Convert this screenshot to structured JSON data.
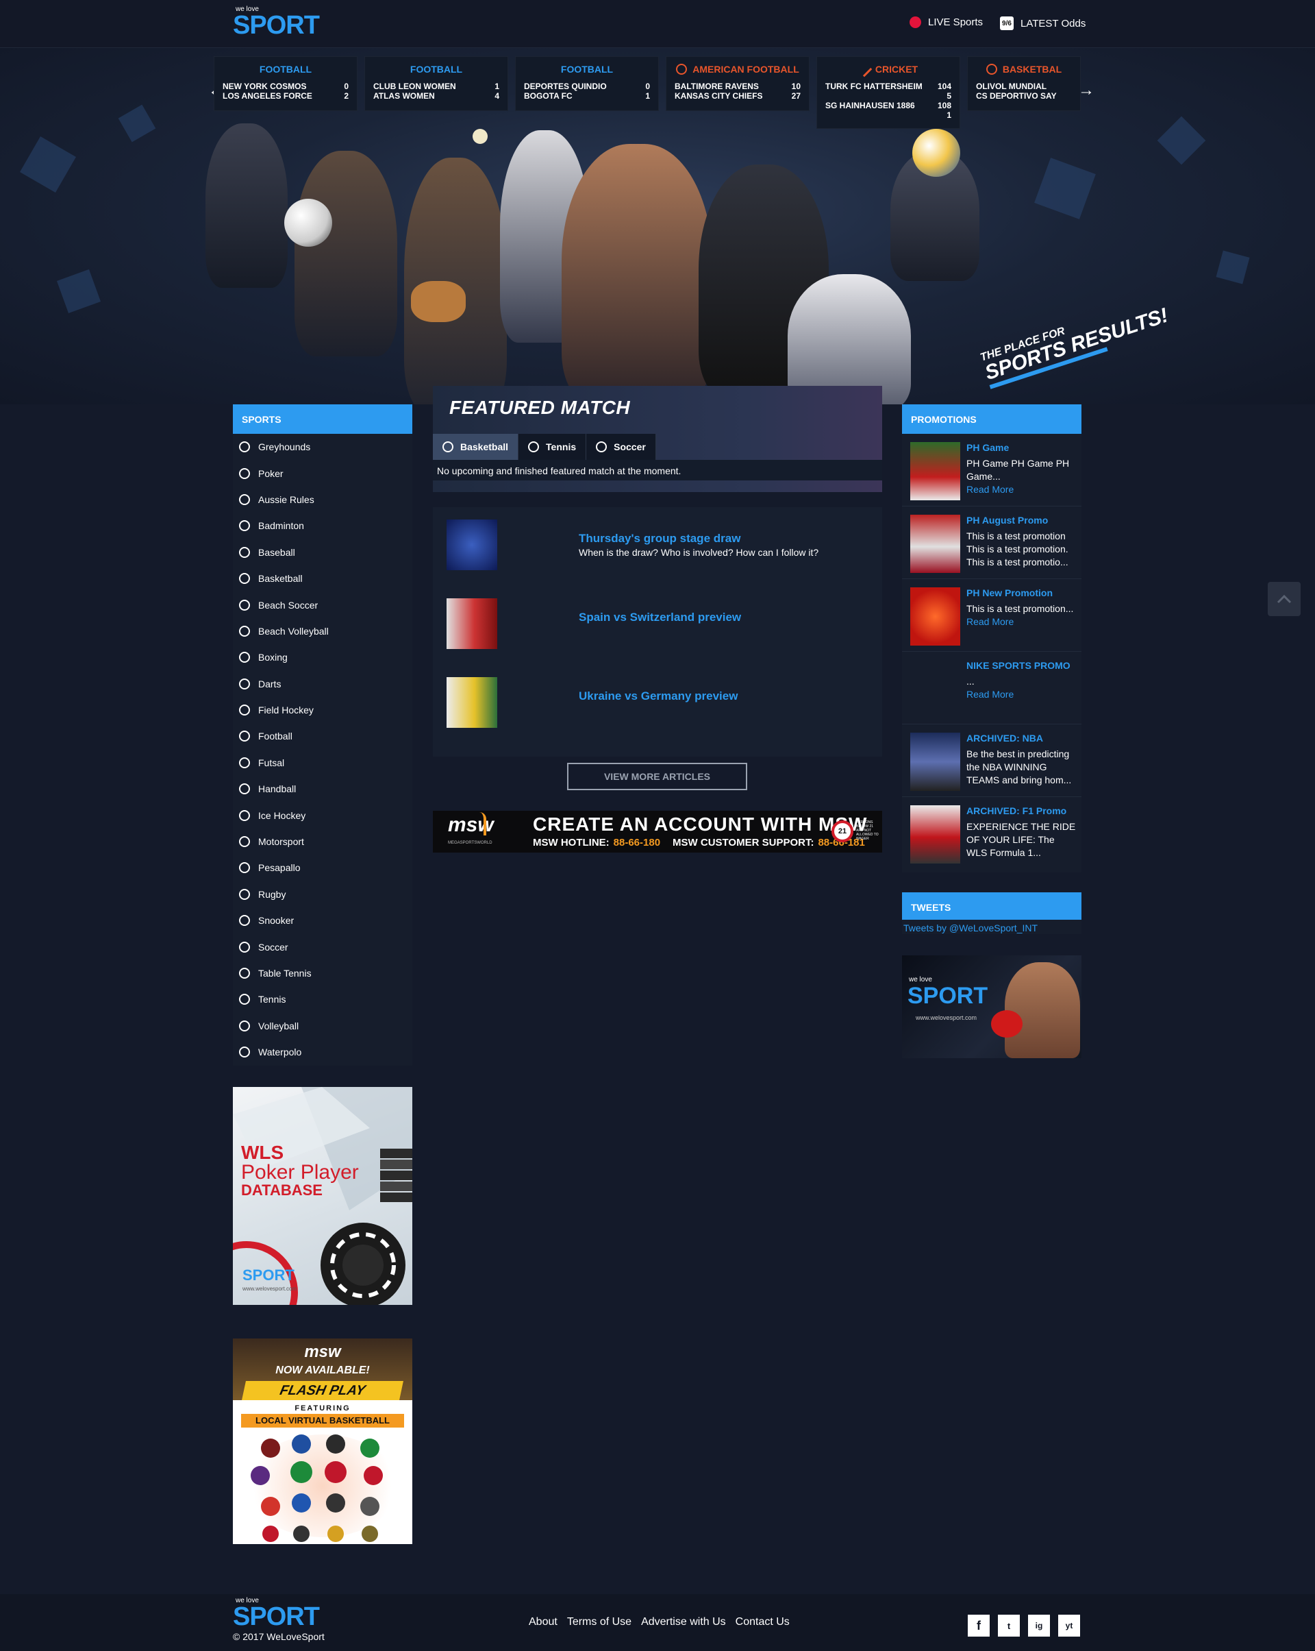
{
  "header": {
    "logo_small": "we love",
    "logo_main": "SPORT",
    "live_label": "LIVE Sports",
    "odds_label": "LATEST Odds",
    "odds_icon_text": "9/6"
  },
  "ticker": {
    "prev": "←",
    "next": "→",
    "cards": [
      {
        "sport": "FOOTBALL",
        "color": "#2d9bf0",
        "rows": [
          {
            "team": "NEW YORK COSMOS",
            "score": "0"
          },
          {
            "team": "LOS ANGELES FORCE",
            "score": "2"
          }
        ]
      },
      {
        "sport": "FOOTBALL",
        "color": "#2d9bf0",
        "rows": [
          {
            "team": "CLUB LEON WOMEN",
            "score": "1"
          },
          {
            "team": "ATLAS WOMEN",
            "score": "4"
          }
        ]
      },
      {
        "sport": "FOOTBALL",
        "color": "#2d9bf0",
        "rows": [
          {
            "team": "DEPORTES QUINDIO",
            "score": "0"
          },
          {
            "team": "BOGOTA FC",
            "score": "1"
          }
        ]
      },
      {
        "sport": "AMERICAN FOOTBALL",
        "color": "#e8552b",
        "rows": [
          {
            "team": "BALTIMORE RAVENS",
            "score": "10"
          },
          {
            "team": "KANSAS CITY CHIEFS",
            "score": "27"
          }
        ]
      },
      {
        "sport": "CRICKET",
        "color": "#e8552b",
        "rows": [
          {
            "team": "TURK FC HATTERSHEIM",
            "score": "104"
          },
          {
            "team": "",
            "score": "5"
          },
          {
            "team": "SG HAINHAUSEN 1886",
            "score": "108"
          },
          {
            "team": "",
            "score": "1"
          }
        ]
      },
      {
        "sport": "BASKETBAL",
        "color": "#e8552b",
        "rows": [
          {
            "team": "OLIVOL MUNDIAL",
            "score": ""
          },
          {
            "team": "CS DEPORTIVO SAY",
            "score": ""
          }
        ]
      }
    ]
  },
  "hero": {
    "tagline_small": "THE PLACE FOR",
    "tagline_big": "SPORTS RESULTS!"
  },
  "sports": {
    "heading": "SPORTS",
    "items": [
      "Greyhounds",
      "Poker",
      "Aussie Rules",
      "Badminton",
      "Baseball",
      "Basketball",
      "Beach Soccer",
      "Beach Volleyball",
      "Boxing",
      "Darts",
      "Field Hockey",
      "Football",
      "Futsal",
      "Handball",
      "Ice Hockey",
      "Motorsport",
      "Pesapallo",
      "Rugby",
      "Snooker",
      "Soccer",
      "Table Tennis",
      "Tennis",
      "Volleyball",
      "Waterpolo"
    ]
  },
  "ads": {
    "poker_line1": "WLS",
    "poker_line2": "Poker Player",
    "poker_line3": "DATABASE",
    "poker_url": "www.welovesport.com",
    "flash_brand": "msw",
    "flash_available": "NOW AVAILABLE!",
    "flash_play": "FLASH PLAY",
    "flash_featuring": "FEATURING",
    "flash_local": "LOCAL VIRTUAL BASKETBALL",
    "boxer_url": "www.welovesport.com"
  },
  "featured": {
    "title": "FEATURED MATCH",
    "tabs": [
      "Basketball",
      "Tennis",
      "Soccer"
    ],
    "message": "No upcoming and finished featured match at the moment."
  },
  "articles": [
    {
      "title": "Thursday's group stage draw",
      "subtitle": "When is the draw? Who is involved? How can I follow it?"
    },
    {
      "title": "Spain vs Switzerland preview",
      "subtitle": ""
    },
    {
      "title": "Ukraine vs Germany preview",
      "subtitle": ""
    }
  ],
  "view_more": "VIEW MORE ARTICLES",
  "msw_banner": {
    "brand": "msw",
    "brand_sub": "MEGASPORTSWORLD",
    "headline": "CREATE AN ACCOUNT WITH MSW",
    "hotline_label": "MSW HOTLINE:",
    "hotline": "88-66-180",
    "support_label": "MSW CUSTOMER SUPPORT:",
    "support": "88-66-181",
    "age_badge": "21",
    "age_note": "PERSONS BELOW 21 ARE NOT ALLOWED TO WAGER"
  },
  "promotions": {
    "heading": "PROMOTIONS",
    "items": [
      {
        "title": "PH Game",
        "desc": " PH Game PH Game PH Game...",
        "more": "Read More"
      },
      {
        "title": "PH August Promo",
        "desc": "This is a test promotion This is a test promotion. This is a test promotio...",
        "more": ""
      },
      {
        "title": "PH New Promotion",
        "desc": "This is a test promotion...",
        "more": "Read More"
      },
      {
        "title": "NIKE SPORTS PROMO",
        "desc": "...",
        "more": "Read More"
      },
      {
        "title": "ARCHIVED: NBA",
        "desc": "Be the best in predicting the NBA WINNING TEAMS and bring hom...",
        "more": ""
      },
      {
        "title": "ARCHIVED: F1 Promo",
        "desc": "EXPERIENCE THE RIDE OF YOUR LIFE: The WLS Formula 1...",
        "more": ""
      }
    ]
  },
  "tweets": {
    "heading": "TWEETS",
    "link": "Tweets by @WeLoveSport_INT"
  },
  "footer": {
    "copyright": "© 2017 WeLoveSport",
    "links": [
      "About",
      "Terms of Use",
      "Advertise with Us",
      "Contact Us"
    ],
    "social": [
      "f",
      "t",
      "ig",
      "yt"
    ]
  },
  "colors": {
    "accent": "#2d9bf0",
    "alert": "#e8552b",
    "background": "#141a2a",
    "live": "#e3143b"
  }
}
